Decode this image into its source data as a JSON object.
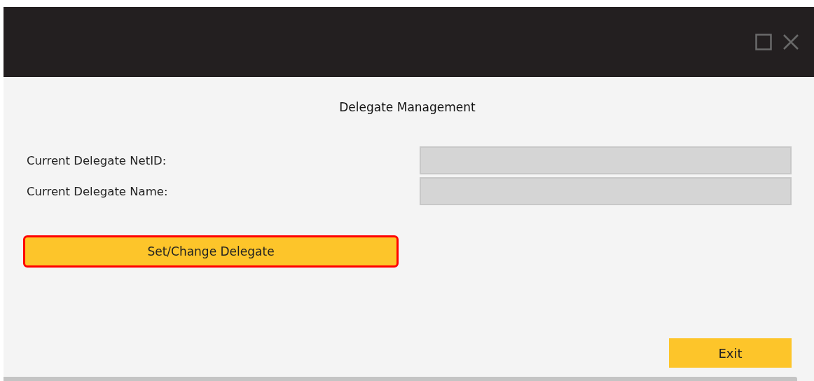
{
  "window": {
    "title": "Delegate Management"
  },
  "fields": [
    {
      "label": "Current Delegate NetID:",
      "disabled": true
    },
    {
      "label": "Current Delegate Name:",
      "disabled": true
    }
  ],
  "action_button": {
    "label": "Set/Change Delegate",
    "highlighted": true
  },
  "exit_button": {
    "label": "Exit"
  }
}
